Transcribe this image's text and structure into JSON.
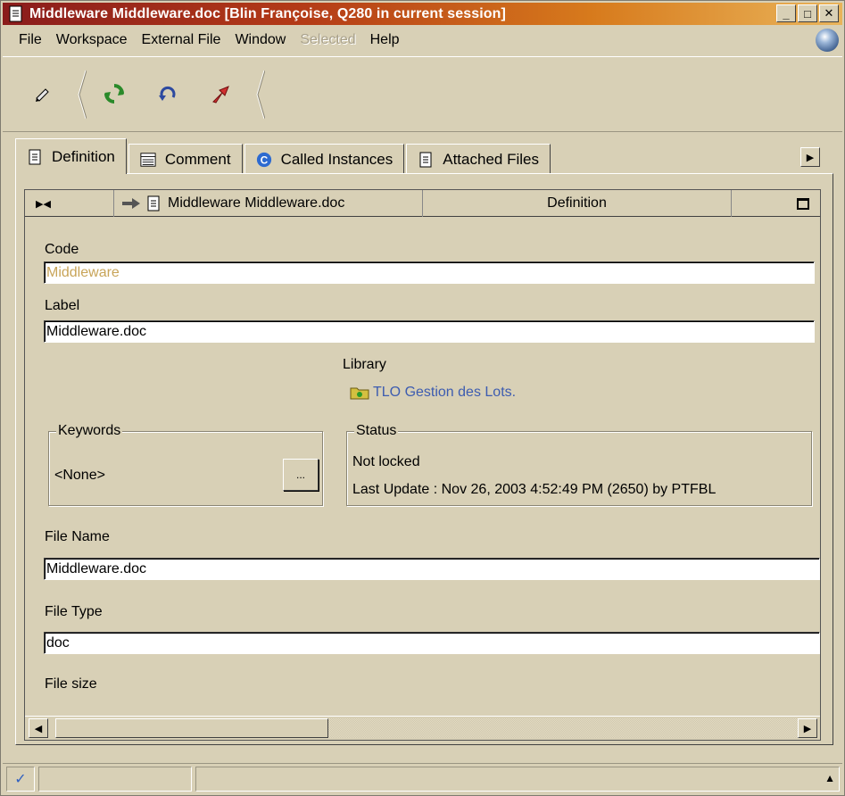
{
  "window": {
    "title": "Middleware Middleware.doc [Blin Françoise, Q280 in current session]",
    "buttons": {
      "minimize": "_",
      "maximize": "□",
      "close": "✕"
    }
  },
  "menu": {
    "items": [
      {
        "label": "File",
        "disabled": false
      },
      {
        "label": "Workspace",
        "disabled": false
      },
      {
        "label": "External File",
        "disabled": false
      },
      {
        "label": "Window",
        "disabled": false
      },
      {
        "label": "Selected",
        "disabled": true
      },
      {
        "label": "Help",
        "disabled": false
      }
    ]
  },
  "toolbar": {
    "buttons": [
      {
        "name": "edit-icon"
      },
      {
        "name": "refresh-icon"
      },
      {
        "name": "undo-icon"
      },
      {
        "name": "external-arrow-icon"
      }
    ]
  },
  "tabs": [
    {
      "label": "Definition",
      "icon": "document-icon",
      "active": true
    },
    {
      "label": "Comment",
      "icon": "comment-icon",
      "active": false
    },
    {
      "label": "Called Instances",
      "icon": "called-instances-icon",
      "active": false
    },
    {
      "label": "Attached Files",
      "icon": "document-icon",
      "active": false
    }
  ],
  "header": {
    "object_name": "Middleware Middleware.doc",
    "section": "Definition"
  },
  "form": {
    "code_label": "Code",
    "code_value": "Middleware",
    "label_label": "Label",
    "label_value": "Middleware.doc",
    "library_label": "Library",
    "library_value": "TLO Gestion des Lots.",
    "keywords_title": "Keywords",
    "keywords_value": "<None>",
    "keywords_button": "...",
    "status_title": "Status",
    "status_lock": "Not locked",
    "status_update": "Last Update : Nov 26, 2003 4:52:49 PM (2650)  by PTFBL",
    "file_name_label": "File Name",
    "file_name_value": "Middleware.doc",
    "file_type_label": "File Type",
    "file_type_value": "doc",
    "file_size_label": "File size"
  },
  "statusbar": {
    "check": "✓"
  },
  "colors": {
    "title_start": "#8a1c1c",
    "title_end": "#e9b45a",
    "background": "#d8d0b6",
    "link": "#3d5cb0",
    "disabled_text": "#c8a458"
  }
}
